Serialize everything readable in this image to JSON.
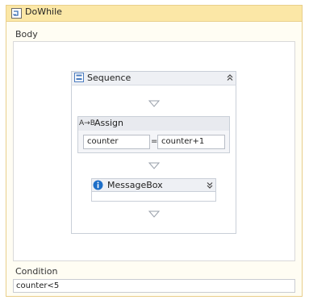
{
  "dowhile": {
    "title": "DoWhile",
    "icon": "dowhile-icon"
  },
  "body": {
    "label": "Body"
  },
  "sequence": {
    "title": "Sequence",
    "icon": "sequence-icon",
    "collapse_icon": "double-chevron-up-icon"
  },
  "assign": {
    "title": "Assign",
    "icon_text": "A→B",
    "to": "counter",
    "operator": "=",
    "value": "counter+1"
  },
  "messagebox": {
    "title": "MessageBox",
    "icon": "info-icon",
    "expand_icon": "double-chevron-down-icon"
  },
  "condition": {
    "label": "Condition",
    "value": "counter<5"
  },
  "colors": {
    "dowhile_header": "#fbe7a6",
    "dowhile_border": "#e9cf8b",
    "activity_border": "#c9cfd8",
    "info_blue": "#1e6fc8"
  }
}
